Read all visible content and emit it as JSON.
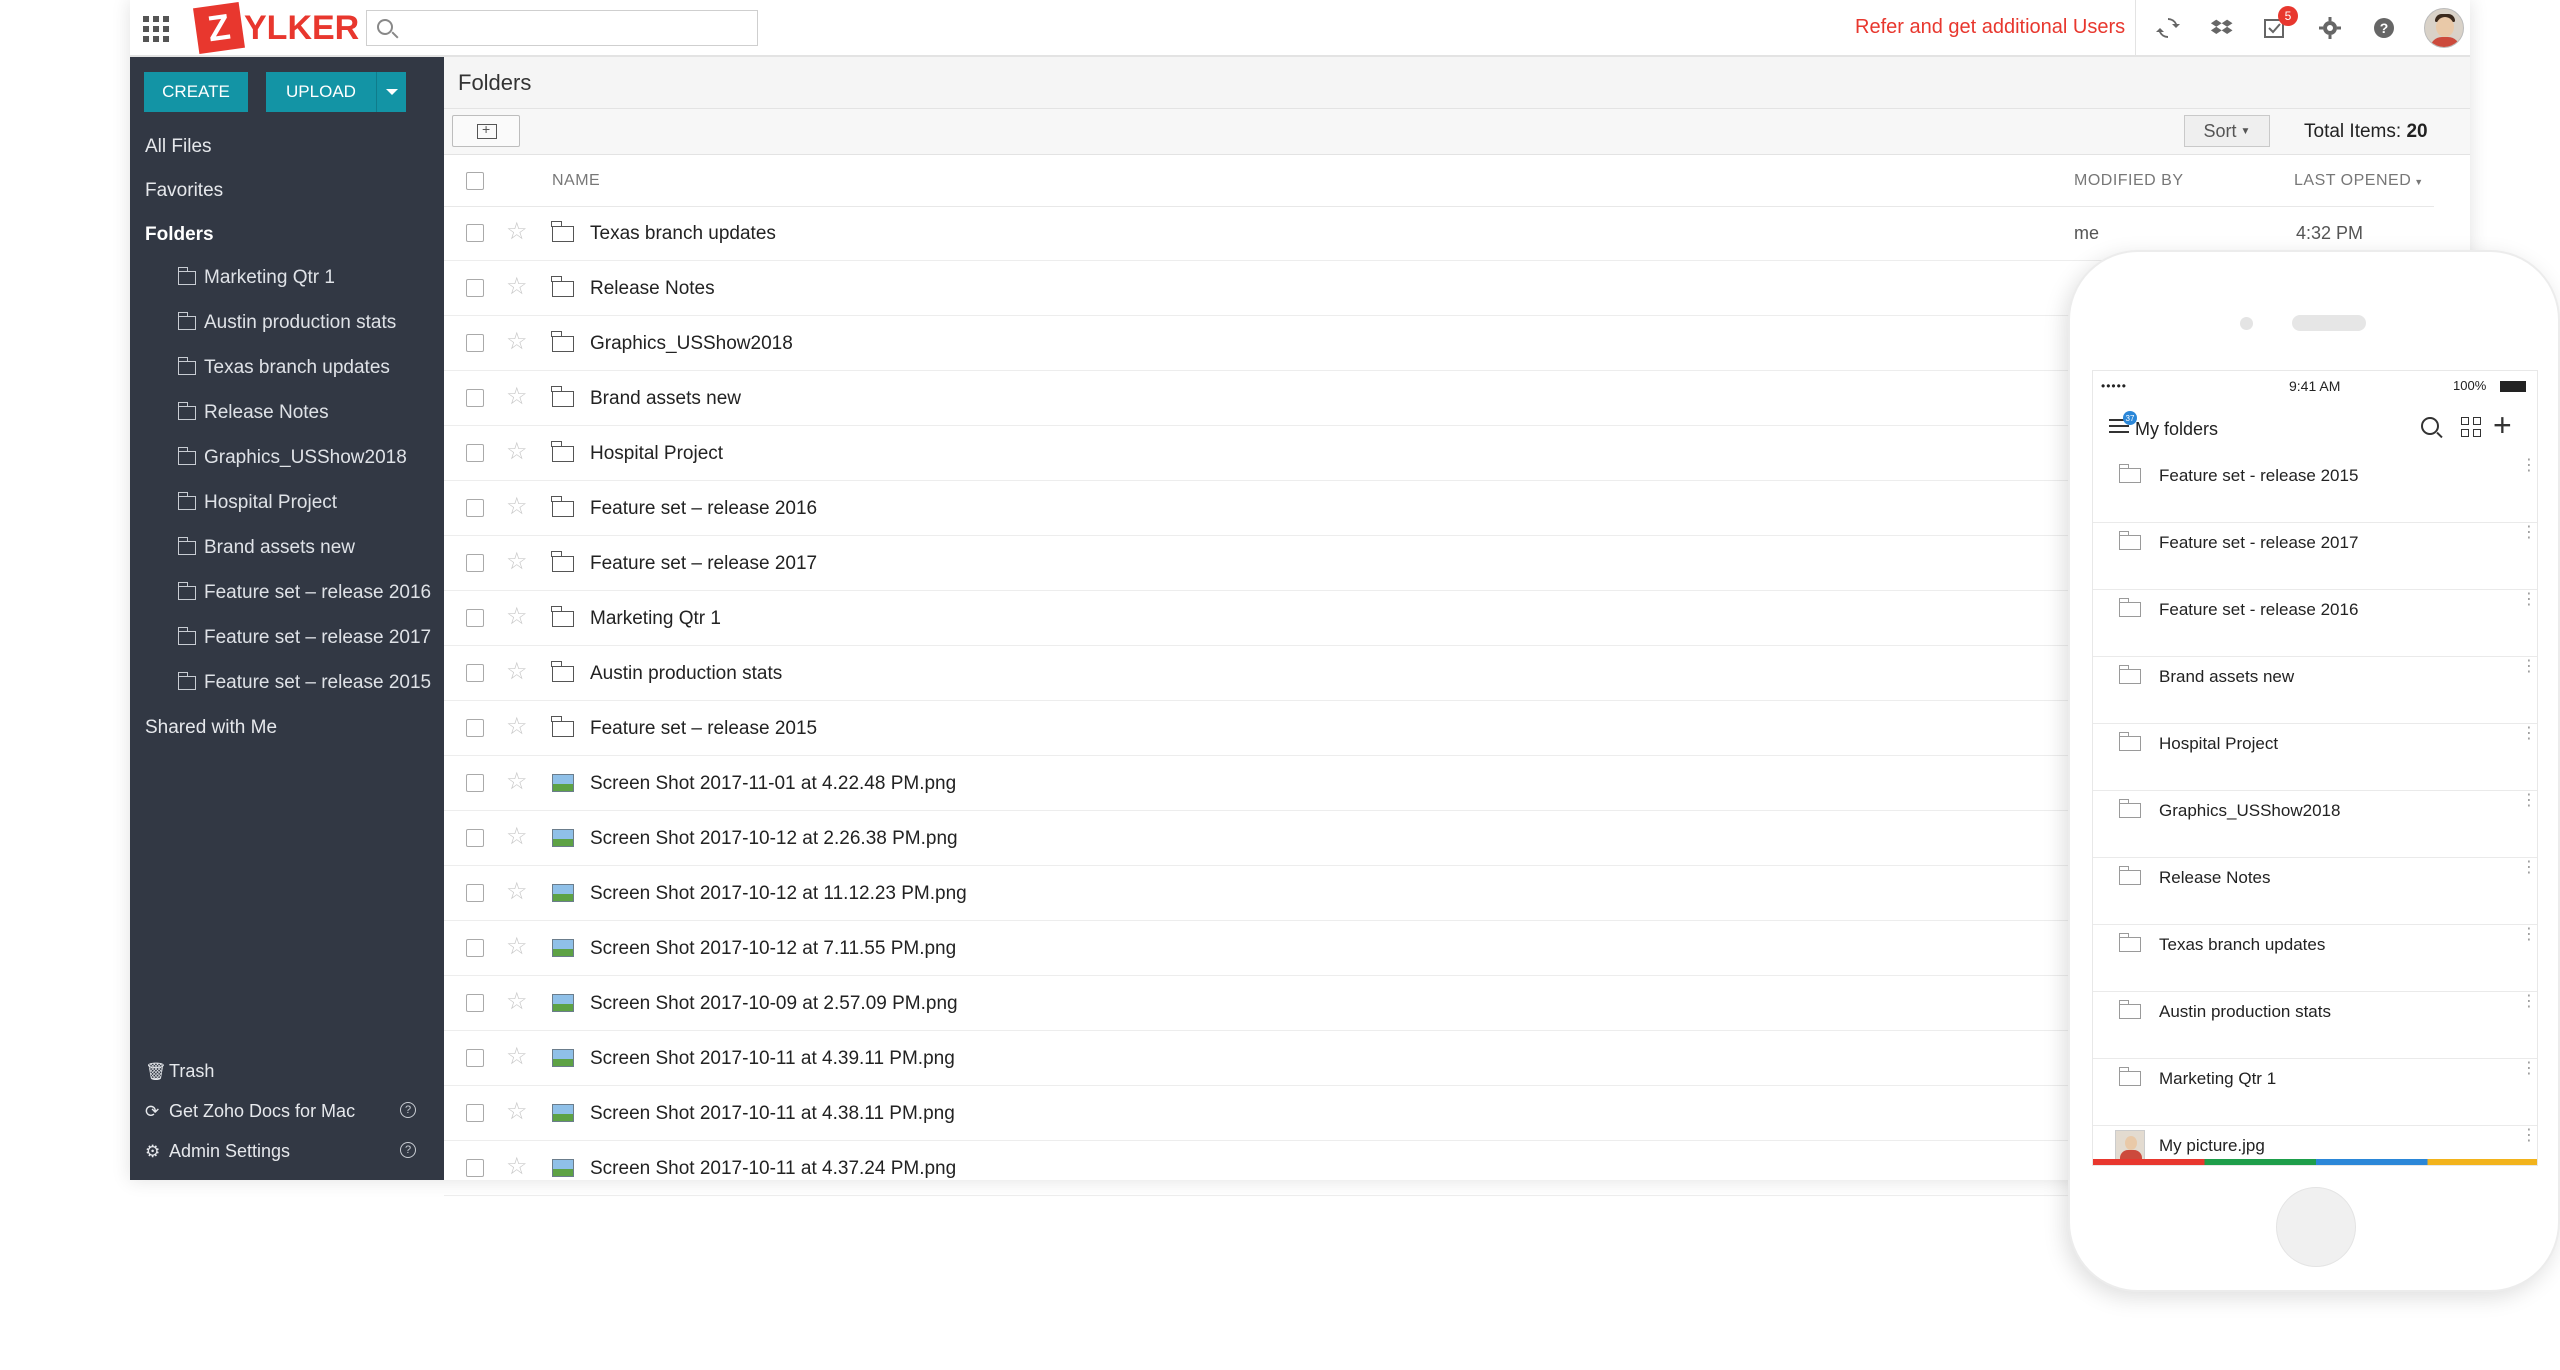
{
  "brand": {
    "logo_letter": "Z",
    "logo_text": "YLKER",
    "accent": "#e8372e",
    "teal": "#1394a5"
  },
  "topbar": {
    "search_placeholder": "",
    "refer_text": "Refer and get additional Users",
    "icons": [
      "sync-icon",
      "dropbox-icon",
      "tasks-icon",
      "settings-icon",
      "help-icon"
    ],
    "tasks_badge": "5"
  },
  "sidebar": {
    "create_label": "CREATE",
    "upload_label": "UPLOAD",
    "all_files": "All Files",
    "favorites": "Favorites",
    "folders": "Folders",
    "folder_items": [
      "Marketing Qtr 1",
      "Austin production stats",
      "Texas branch updates",
      "Release Notes",
      "Graphics_USShow2018",
      "Hospital Project",
      "Brand assets new",
      "Feature set – release 2016",
      "Feature set – release 2017",
      "Feature set – release 2015"
    ],
    "shared": "Shared with Me",
    "trash": "Trash",
    "get_mac": "Get Zoho Docs for Mac",
    "admin": "Admin Settings"
  },
  "main": {
    "title": "Folders",
    "sort_label": "Sort",
    "total_label": "Total Items:",
    "total_value": "20",
    "columns": {
      "name": "NAME",
      "modified": "MODIFIED BY",
      "opened": "LAST OPENED"
    },
    "rows": [
      {
        "type": "folder",
        "name": "Texas branch updates",
        "modified": "me",
        "opened": "4:32 PM"
      },
      {
        "type": "folder",
        "name": "Release Notes",
        "modified": "",
        "opened": ""
      },
      {
        "type": "folder",
        "name": "Graphics_USShow2018",
        "modified": "",
        "opened": ""
      },
      {
        "type": "folder",
        "name": "Brand assets new",
        "modified": "",
        "opened": ""
      },
      {
        "type": "folder",
        "name": "Hospital Project",
        "modified": "",
        "opened": ""
      },
      {
        "type": "folder",
        "name": "Feature set – release 2016",
        "modified": "",
        "opened": ""
      },
      {
        "type": "folder",
        "name": "Feature set – release 2017",
        "modified": "",
        "opened": ""
      },
      {
        "type": "folder",
        "name": "Marketing Qtr 1",
        "modified": "",
        "opened": ""
      },
      {
        "type": "folder",
        "name": "Austin production stats",
        "modified": "",
        "opened": ""
      },
      {
        "type": "folder",
        "name": "Feature set – release 2015",
        "modified": "",
        "opened": ""
      },
      {
        "type": "image",
        "name": "Screen Shot 2017-11-01 at 4.22.48 PM.png",
        "modified": "",
        "opened": ""
      },
      {
        "type": "image",
        "name": "Screen Shot 2017-10-12 at 2.26.38 PM.png",
        "modified": "",
        "opened": ""
      },
      {
        "type": "image",
        "name": "Screen Shot 2017-10-12 at 11.12.23 PM.png",
        "modified": "",
        "opened": ""
      },
      {
        "type": "image",
        "name": "Screen Shot 2017-10-12 at 7.11.55 PM.png",
        "modified": "",
        "opened": ""
      },
      {
        "type": "image",
        "name": "Screen Shot 2017-10-09 at 2.57.09 PM.png",
        "modified": "",
        "opened": ""
      },
      {
        "type": "image",
        "name": "Screen Shot 2017-10-11 at 4.39.11 PM.png",
        "modified": "",
        "opened": ""
      },
      {
        "type": "image",
        "name": "Screen Shot 2017-10-11 at 4.38.11 PM.png",
        "modified": "",
        "opened": ""
      },
      {
        "type": "image",
        "name": "Screen Shot 2017-10-11 at 4.37.24 PM.png",
        "modified": "",
        "opened": ""
      }
    ]
  },
  "phone": {
    "status_time": "9:41 AM",
    "status_battery": "100%",
    "menu_badge": "37",
    "title": "My folders",
    "items": [
      {
        "type": "folder",
        "name": "Feature set - release 2015"
      },
      {
        "type": "folder",
        "name": "Feature set - release 2017"
      },
      {
        "type": "folder",
        "name": "Feature set - release 2016"
      },
      {
        "type": "folder",
        "name": "Brand assets new"
      },
      {
        "type": "folder",
        "name": "Hospital Project"
      },
      {
        "type": "folder",
        "name": "Graphics_USShow2018"
      },
      {
        "type": "folder",
        "name": "Release Notes"
      },
      {
        "type": "folder",
        "name": "Texas branch updates"
      },
      {
        "type": "folder",
        "name": "Austin production stats"
      },
      {
        "type": "folder",
        "name": "Marketing Qtr 1"
      },
      {
        "type": "image",
        "name": "My picture.jpg"
      }
    ]
  }
}
